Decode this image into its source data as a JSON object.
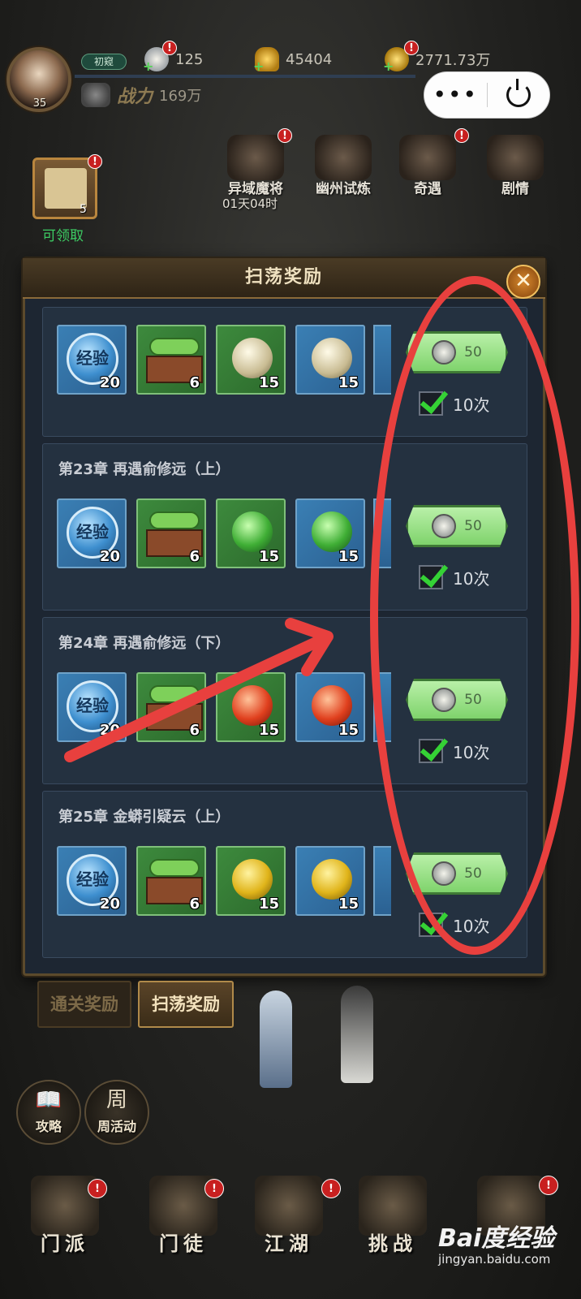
{
  "hud": {
    "level": "35",
    "name_tag": "初窥",
    "resources": [
      {
        "icon": "steamed-bun-icon",
        "value": "125"
      },
      {
        "icon": "ingot-icon",
        "value": "45404"
      },
      {
        "icon": "coin-icon",
        "value": "2771.73万"
      }
    ],
    "power_label": "战力",
    "power_value": "169万"
  },
  "capsule": {
    "more": "•••"
  },
  "claim": {
    "count": "5",
    "label": "可领取"
  },
  "events": [
    {
      "label": "异域魔将",
      "timer": "01天04时"
    },
    {
      "label": "幽州试炼"
    },
    {
      "label": "奇遇"
    },
    {
      "label": "剧情"
    }
  ],
  "dialog": {
    "title": "扫荡奖励",
    "close": "✕",
    "sweep_cost": "50",
    "times": "10次",
    "exp_label": "经验",
    "chapters": [
      {
        "title": "",
        "items": [
          {
            "kind": "exp",
            "count": "20"
          },
          {
            "kind": "book",
            "count": "6"
          },
          {
            "kind": "pearl-white",
            "count": "15"
          },
          {
            "kind": "pearl-white",
            "count": "15"
          }
        ]
      },
      {
        "title": "第23章 再遇俞修远（上）",
        "items": [
          {
            "kind": "exp",
            "count": "20"
          },
          {
            "kind": "book",
            "count": "6"
          },
          {
            "kind": "pearl-green",
            "count": "15"
          },
          {
            "kind": "pearl-green",
            "count": "15"
          }
        ]
      },
      {
        "title": "第24章 再遇俞修远（下）",
        "items": [
          {
            "kind": "exp",
            "count": "20"
          },
          {
            "kind": "book",
            "count": "6"
          },
          {
            "kind": "pearl-red",
            "count": "15"
          },
          {
            "kind": "pearl-red",
            "count": "15"
          }
        ]
      },
      {
        "title": "第25章 金蟒引疑云（上）",
        "items": [
          {
            "kind": "exp",
            "count": "20"
          },
          {
            "kind": "book",
            "count": "6"
          },
          {
            "kind": "pearl-gold",
            "count": "15"
          },
          {
            "kind": "pearl-gold",
            "count": "15"
          }
        ]
      }
    ]
  },
  "tabs": {
    "clear_reward": "通关奖励",
    "sweep_reward": "扫荡奖励"
  },
  "side_buttons": [
    {
      "glyph": "📖",
      "label": "攻略"
    },
    {
      "glyph": "周",
      "label": "周活动"
    }
  ],
  "bottom_nav": [
    {
      "label": "门派"
    },
    {
      "label": "门徒"
    },
    {
      "label": "江湖"
    },
    {
      "label": "挑战"
    }
  ],
  "badge": "!",
  "watermark": {
    "brand": "Bai度经验",
    "url": "jingyan.baidu.com"
  },
  "colors": {
    "annotation": "#e8403e",
    "check": "#35d235"
  }
}
